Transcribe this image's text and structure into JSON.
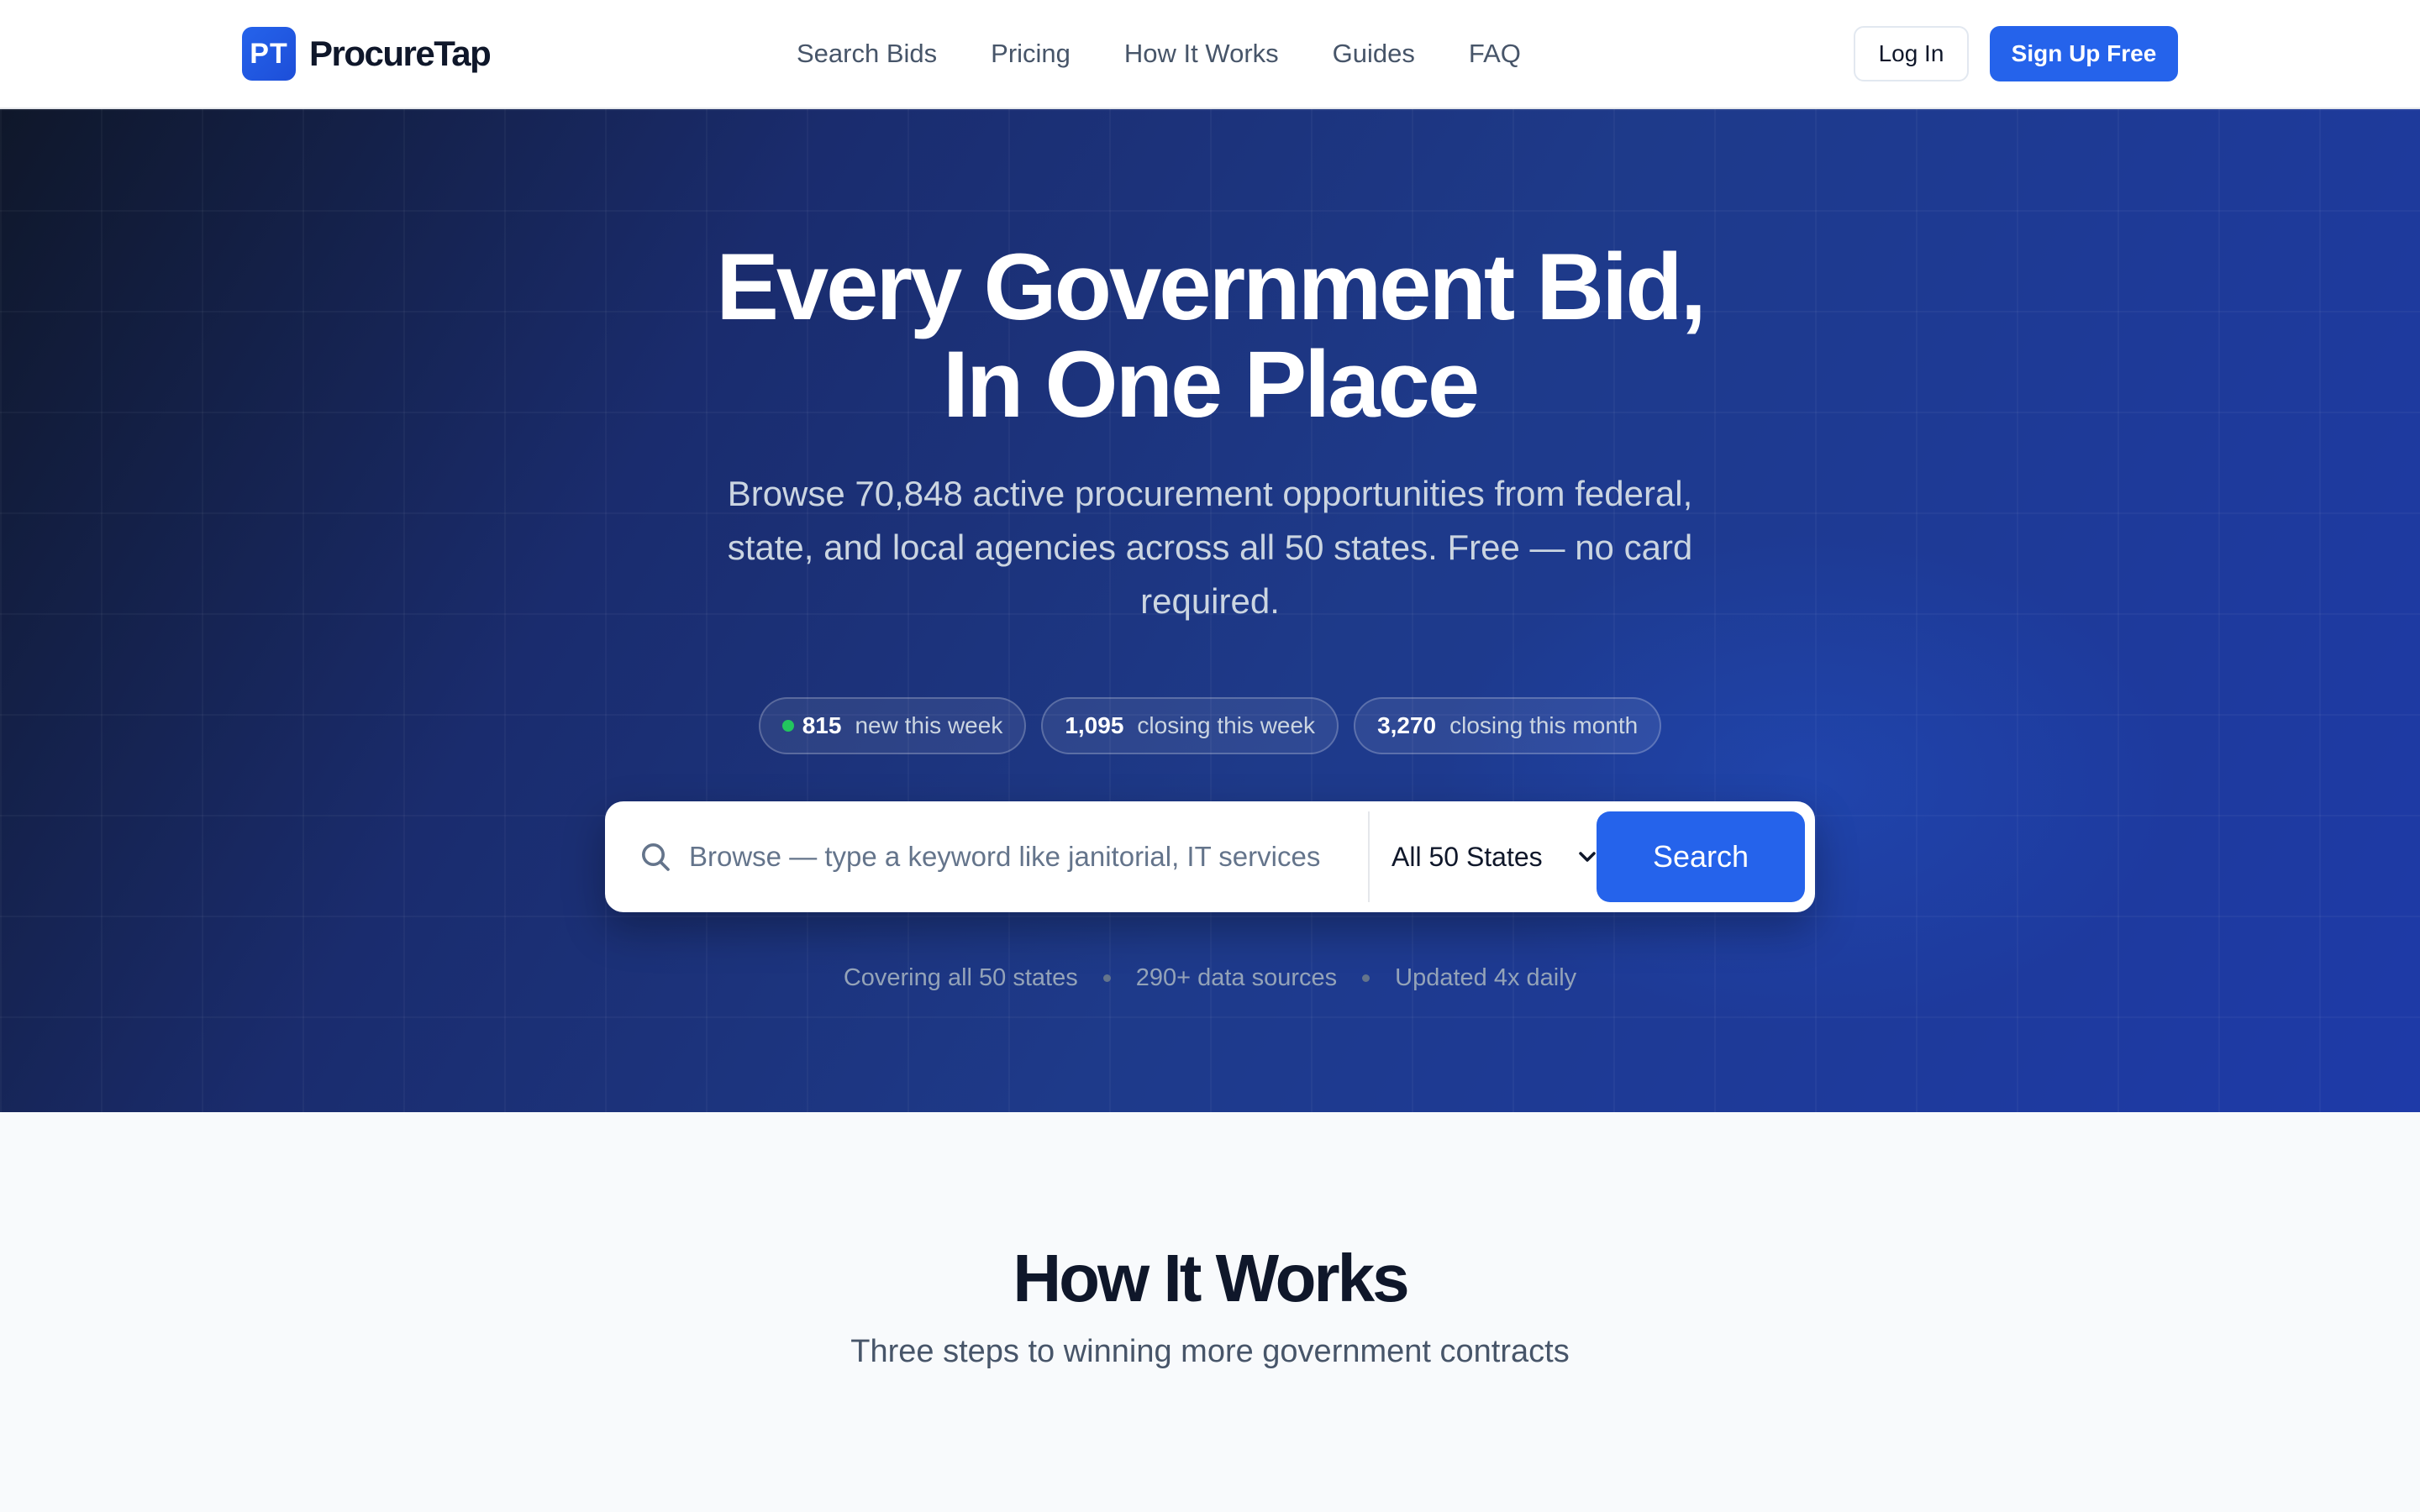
{
  "nav": {
    "logo_mark": "PT",
    "logo_text": "ProcureTap",
    "links": [
      "Search Bids",
      "Pricing",
      "How It Works",
      "Guides",
      "FAQ"
    ],
    "login_label": "Log In",
    "signup_label": "Sign Up Free"
  },
  "hero": {
    "title_line1": "Every Government Bid,",
    "title_line2": "In One Place",
    "subtitle": "Browse 70,848 active procurement opportunities from federal, state, and local agencies across all 50 states. Free — no card required.",
    "stats": [
      {
        "value": "815",
        "label": "new this week",
        "live": true
      },
      {
        "value": "1,095",
        "label": "closing this week",
        "live": false
      },
      {
        "value": "3,270",
        "label": "closing this month",
        "live": false
      }
    ],
    "search": {
      "placeholder": "Browse — type a keyword like janitorial, IT services",
      "state_selected": "All 50 States",
      "button_label": "Search"
    },
    "meta": [
      "Covering all 50 states",
      "290+ data sources",
      "Updated 4x daily"
    ]
  },
  "how_it_works": {
    "title": "How It Works",
    "subtitle": "Three steps to winning more government contracts"
  },
  "colors": {
    "accent": "#2563eb",
    "hero_dark": "#0f172a",
    "hero_blue": "#1e3a8a",
    "live_green": "#22c55e"
  },
  "icons": {
    "search": "search-icon",
    "select_chevron": "chevron-down-icon"
  }
}
